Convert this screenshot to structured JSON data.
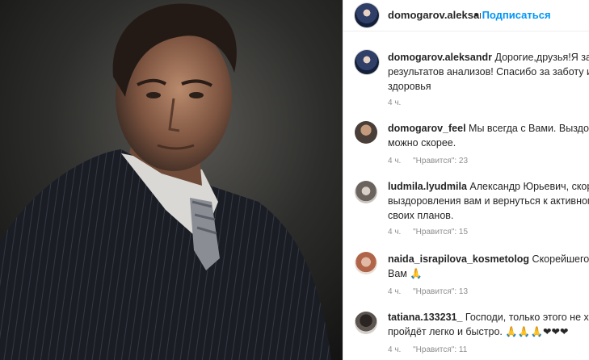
{
  "header": {
    "username": "domogarov.aleksandr",
    "follow_label": "Подписаться"
  },
  "caption": {
    "username": "domogarov.aleksandr",
    "lines": [
      "Дорогие,друзья!Я заболел",
      "результатов анализов! Спасибо за заботу и под",
      "здоровья"
    ],
    "time": "4 ч."
  },
  "comments": [
    {
      "username": "domogarov_feel",
      "lines": [
        "Мы всегда с Вами. Выздоравли",
        "можно скорее."
      ],
      "time": "4 ч.",
      "likes": "\"Нравится\": 23"
    },
    {
      "username": "ludmila.lyudmila",
      "lines": [
        "Александр Юрьевич, скорейш",
        "выздоровления вам и вернуться к активному во",
        "своих планов."
      ],
      "time": "4 ч.",
      "likes": "\"Нравится\": 15"
    },
    {
      "username": "naida_israpilova_kosmetolog",
      "lines": [
        "Скорейшего выздо",
        "Вам 🙏"
      ],
      "time": "4 ч.",
      "likes": "\"Нравится\": 13"
    },
    {
      "username": "tatiana.133231_",
      "lines": [
        "Господи, только этого не хвата",
        "пройдёт легко и быстро. 🙏🙏🙏❤❤❤"
      ],
      "time": "4 ч.",
      "likes": "\"Нравится\": 11"
    }
  ],
  "icons": {
    "header_avatar": "profile-avatar",
    "more": "more-dot"
  }
}
